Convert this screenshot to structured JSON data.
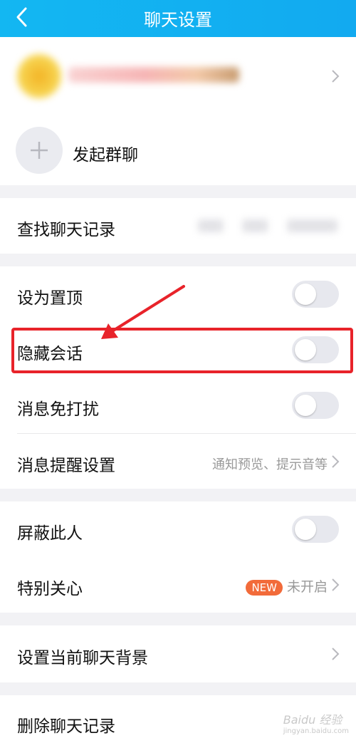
{
  "header": {
    "title": "聊天设置"
  },
  "add_group": {
    "label": "发起群聊"
  },
  "search_history": {
    "label": "查找聊天记录"
  },
  "settings": {
    "pin": "设为置顶",
    "hide": "隐藏会话",
    "dnd": "消息免打扰",
    "notify": "消息提醒设置",
    "notify_value": "通知预览、提示音等"
  },
  "privacy": {
    "block": "屏蔽此人",
    "special": "特别关心",
    "special_badge": "NEW",
    "special_value": "未开启"
  },
  "background": {
    "label": "设置当前聊天背景"
  },
  "delete": {
    "label": "删除聊天记录"
  },
  "watermark": {
    "text": "Baidu 经验",
    "sub": "jingyan.baidu.com"
  },
  "colors": {
    "header": "#13b7f2",
    "highlight": "#e8232a",
    "badge": "#f26b3a"
  }
}
